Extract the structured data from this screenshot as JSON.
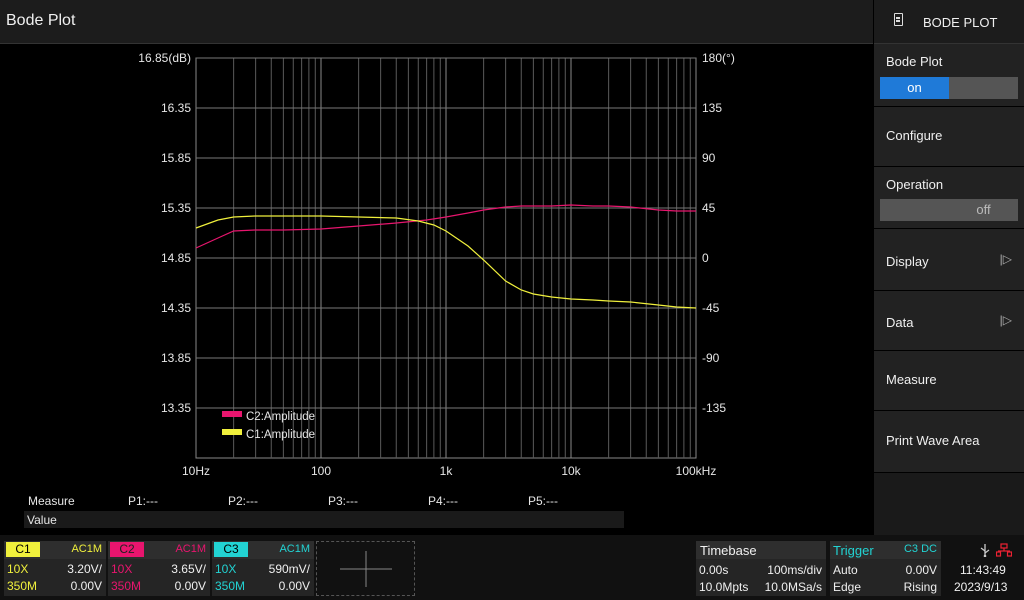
{
  "app": {
    "title": "Bode Plot"
  },
  "menu": {
    "title": "BODE PLOT",
    "icon": "document-icon",
    "items": {
      "bode_plot": {
        "label": "Bode Plot",
        "on": "on",
        "off": ""
      },
      "configure": {
        "label": "Configure"
      },
      "operation": {
        "label": "Operation",
        "on": "",
        "off": "off"
      },
      "display": {
        "label": "Display",
        "arrow": "|▷"
      },
      "data": {
        "label": "Data",
        "arrow": "|▷"
      },
      "measure": {
        "label": "Measure"
      },
      "print_wave_area": {
        "label": "Print Wave Area"
      }
    }
  },
  "chart_data": {
    "type": "line",
    "x_scale": "log",
    "xlim": [
      10,
      100000
    ],
    "x_ticks": [
      "10Hz",
      "100",
      "1k",
      "10k",
      "100kHz"
    ],
    "y_left_ticks": [
      "16.85(dB)",
      "16.35",
      "15.85",
      "15.35",
      "14.85",
      "14.35",
      "13.85",
      "13.35"
    ],
    "y_left_values": [
      16.85,
      16.35,
      15.85,
      15.35,
      14.85,
      14.35,
      13.85,
      13.35
    ],
    "y_right_ticks": [
      "180(°)",
      "135",
      "90",
      "45",
      "0",
      "-45",
      "-90",
      "-135"
    ],
    "ylim": [
      12.85,
      16.85
    ],
    "grid": true,
    "legend_position": "bottom-left",
    "series": [
      {
        "name": "C2:Amplitude",
        "color": "#e8156e",
        "x": [
          10,
          15,
          20,
          30,
          50,
          100,
          200,
          400,
          700,
          1000,
          1500,
          2000,
          3000,
          4000,
          5000,
          7000,
          10000,
          15000,
          20000,
          30000,
          50000,
          70000,
          100000
        ],
        "y": [
          14.95,
          15.05,
          15.12,
          15.13,
          15.13,
          15.14,
          15.17,
          15.2,
          15.23,
          15.26,
          15.3,
          15.33,
          15.36,
          15.37,
          15.37,
          15.37,
          15.38,
          15.37,
          15.37,
          15.36,
          15.33,
          15.32,
          15.32
        ]
      },
      {
        "name": "C1:Amplitude",
        "color": "#f0f03c",
        "x": [
          10,
          15,
          20,
          30,
          50,
          100,
          200,
          400,
          600,
          800,
          1000,
          1500,
          2000,
          3000,
          4000,
          5000,
          7000,
          10000,
          15000,
          20000,
          30000,
          50000,
          70000,
          100000
        ],
        "y": [
          15.15,
          15.23,
          15.26,
          15.27,
          15.27,
          15.27,
          15.26,
          15.25,
          15.22,
          15.18,
          15.12,
          14.97,
          14.83,
          14.62,
          14.53,
          14.49,
          14.46,
          14.44,
          14.43,
          14.42,
          14.41,
          14.38,
          14.36,
          14.35
        ]
      }
    ]
  },
  "measure": {
    "header": "Measure",
    "p1": "P1:---",
    "p2": "P2:---",
    "p3": "P3:---",
    "p4": "P4:---",
    "p5": "P5:---",
    "value_label": "Value"
  },
  "channels": [
    {
      "tag": "C1",
      "coupling": "AC1M",
      "probe": "10X",
      "scale": "3.20V/",
      "bw": "350M",
      "offset": "0.00V",
      "color": "#f0f03c"
    },
    {
      "tag": "C2",
      "coupling": "AC1M",
      "probe": "10X",
      "scale": "3.65V/",
      "bw": "350M",
      "offset": "0.00V",
      "color": "#e8156e"
    },
    {
      "tag": "C3",
      "coupling": "AC1M",
      "probe": "10X",
      "scale": "590mV/",
      "bw": "350M",
      "offset": "0.00V",
      "color": "#22d3d3"
    }
  ],
  "timebase": {
    "label": "Timebase",
    "delay": "0.00s",
    "scale": "100ms/div",
    "mem": "10.0Mpts",
    "rate": "10.0MSa/s"
  },
  "trigger": {
    "label": "Trigger",
    "source": "C3 DC",
    "mode": "Auto",
    "level": "0.00V",
    "type": "Edge",
    "slope": "Rising"
  },
  "status": {
    "time": "11:43:49",
    "date": "2023/9/13",
    "usb_icon": "usb-icon",
    "network_icon": "network-icon"
  }
}
